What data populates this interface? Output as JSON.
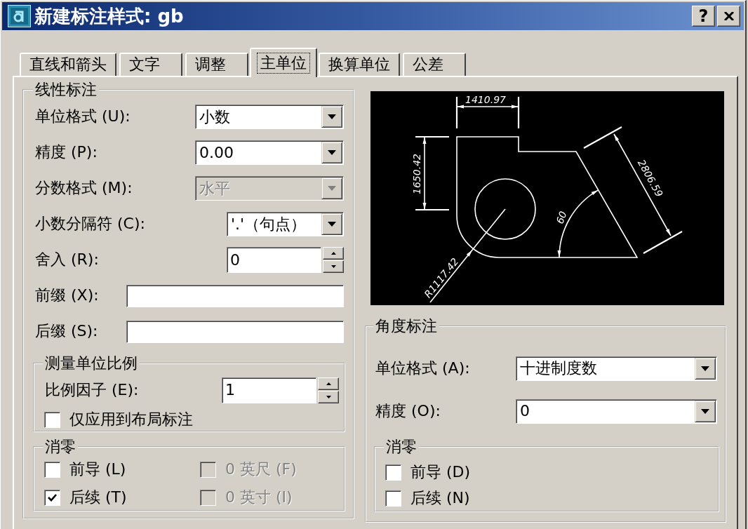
{
  "window": {
    "title": "新建标注样式: gb",
    "help_button": "?"
  },
  "tabs": [
    {
      "label": "直线和箭头",
      "selected": false
    },
    {
      "label": "文字",
      "selected": false
    },
    {
      "label": "调整",
      "selected": false
    },
    {
      "label": "主单位",
      "selected": true
    },
    {
      "label": "换算单位",
      "selected": false
    },
    {
      "label": "公差",
      "selected": false
    }
  ],
  "linear_dimensions": {
    "title": "线性标注",
    "fields": [
      {
        "kind": "combo",
        "label": "单位格式 (U):",
        "value": "小数",
        "disabled": false
      },
      {
        "kind": "combo",
        "label": "精度 (P):",
        "value": "0.00",
        "disabled": false
      },
      {
        "kind": "combo",
        "label": "分数格式 (M):",
        "value": "水平",
        "disabled": true
      },
      {
        "kind": "combo",
        "label": "小数分隔符 (C):",
        "value": "'.'（句点）",
        "disabled": false
      },
      {
        "kind": "spinner",
        "label": "舍入 (R):",
        "value": "0",
        "disabled": false
      },
      {
        "kind": "text",
        "label": "前缀 (X):",
        "disabled": false
      },
      {
        "kind": "text",
        "label": "后缀 (S):",
        "disabled": false
      }
    ],
    "scale": {
      "title": "测量单位比例",
      "fields": [
        {
          "kind": "spinner",
          "label": "比例因子 (E):",
          "value": "1",
          "disabled": false
        }
      ],
      "options": [
        {
          "label": "仅应用到布局标注",
          "checked": false,
          "disabled": false
        }
      ]
    },
    "zero_suppression": {
      "title": "消零",
      "options": [
        {
          "label": "前导 (L)",
          "checked": false,
          "disabled": false
        },
        {
          "label": "0 英尺 (F)",
          "checked": false,
          "disabled": true
        },
        {
          "label": "后续 (T)",
          "checked": true,
          "disabled": false
        },
        {
          "label": "0 英寸 (I)",
          "checked": false,
          "disabled": true
        }
      ]
    }
  },
  "preview": {
    "dimension_labels": [
      "1410.97",
      "1650.42",
      "2806.59",
      "60",
      "R1117.42"
    ]
  },
  "angular_dimensions": {
    "title": "角度标注",
    "fields": [
      {
        "kind": "combo",
        "label": "单位格式 (A):",
        "value": "十进制度数",
        "disabled": false
      },
      {
        "kind": "combo",
        "label": "精度 (O):",
        "value": "0",
        "disabled": false
      }
    ],
    "zero_suppression": {
      "title": "消零",
      "options": [
        {
          "label": "前导 (D)",
          "checked": false,
          "disabled": false
        },
        {
          "label": "后续 (N)",
          "checked": false,
          "disabled": false
        }
      ]
    }
  }
}
